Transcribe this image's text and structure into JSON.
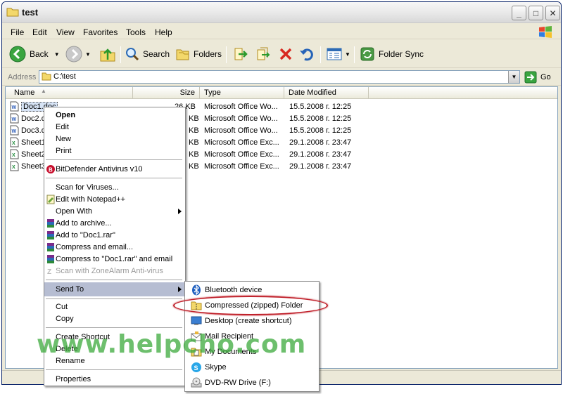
{
  "window": {
    "title": "test",
    "title_icon": "folder-icon",
    "controls": {
      "minimize": "_",
      "maximize": "□",
      "close": "✕"
    }
  },
  "menubar": [
    "File",
    "Edit",
    "View",
    "Favorites",
    "Tools",
    "Help"
  ],
  "toolbar": {
    "back": "Back",
    "search": "Search",
    "folders": "Folders",
    "folder_sync": "Folder Sync"
  },
  "address": {
    "label": "Address",
    "value": "C:\\test",
    "go": "Go"
  },
  "columns": [
    "Name",
    "Size",
    "Type",
    "Date Modified"
  ],
  "files": [
    {
      "name": "Doc1.doc",
      "size": "26 KB",
      "type": "Microsoft Office Wo...",
      "date": "15.5.2008 г. 12:25",
      "kind": "word"
    },
    {
      "name": "Doc2.d",
      "size": "KB",
      "type": "Microsoft Office Wo...",
      "date": "15.5.2008 г. 12:25",
      "kind": "word"
    },
    {
      "name": "Doc3.d",
      "size": "KB",
      "type": "Microsoft Office Wo...",
      "date": "15.5.2008 г. 12:25",
      "kind": "word"
    },
    {
      "name": "Sheet1",
      "size": "KB",
      "type": "Microsoft Office Exc...",
      "date": "29.1.2008 г. 23:47",
      "kind": "excel"
    },
    {
      "name": "Sheet2",
      "size": "KB",
      "type": "Microsoft Office Exc...",
      "date": "29.1.2008 г. 23:47",
      "kind": "excel"
    },
    {
      "name": "Sheet3",
      "size": "KB",
      "type": "Microsoft Office Exc...",
      "date": "29.1.2008 г. 23:47",
      "kind": "excel"
    }
  ],
  "context_menu": {
    "open": "Open",
    "edit": "Edit",
    "new": "New",
    "print": "Print",
    "bitdefender": "BitDefender Antivirus v10",
    "scan_viruses": "Scan for Viruses...",
    "edit_notepad": "Edit with Notepad++",
    "open_with": "Open With",
    "add_archive": "Add to archive...",
    "add_rar": "Add to \"Doc1.rar\"",
    "compress_email": "Compress and email...",
    "compress_rar_email": "Compress to \"Doc1.rar\" and email",
    "scan_zonealarm": "Scan with ZoneAlarm Anti-virus",
    "send_to": "Send To",
    "cut": "Cut",
    "copy": "Copy",
    "create_shortcut": "Create Shortcut",
    "delete": "Delete",
    "rename": "Rename",
    "properties": "Properties"
  },
  "send_to_menu": [
    {
      "label": "Bluetooth device",
      "icon": "bluetooth-icon"
    },
    {
      "label": "Compressed (zipped) Folder",
      "icon": "zip-folder-icon"
    },
    {
      "label": "Desktop (create shortcut)",
      "icon": "desktop-icon"
    },
    {
      "label": "Mail Recipient",
      "icon": "mail-icon"
    },
    {
      "label": "My Documents",
      "icon": "my-documents-icon"
    },
    {
      "label": "Skype",
      "icon": "skype-icon"
    },
    {
      "label": "DVD-RW Drive (F:)",
      "icon": "dvd-drive-icon"
    }
  ],
  "watermark": "www.helpcho.com",
  "colors": {
    "highlight_ellipse": "#c0212b",
    "watermark": "#3caa3c",
    "xp_border": "#0a246a"
  }
}
